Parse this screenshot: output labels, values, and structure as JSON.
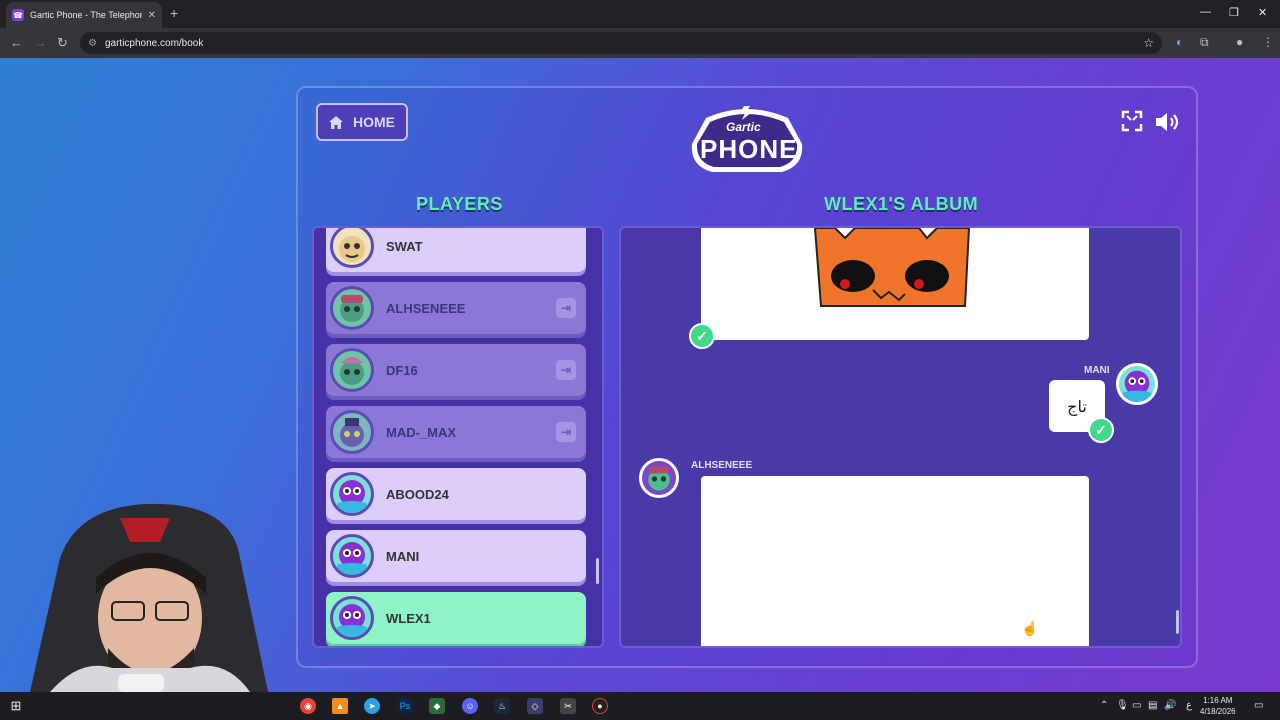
{
  "browser": {
    "tab_title": "Gartic Phone - The Telephone Game",
    "url": "garticphone.com/book"
  },
  "app": {
    "home_label": "HOME",
    "logo_top": "Gartic",
    "logo_bottom": "PHONE",
    "players_heading": "PLAYERS",
    "album_heading": "WLEX1'S ALBUM"
  },
  "players": [
    {
      "name": "SWAT",
      "state": "active"
    },
    {
      "name": "ALHSENEEE",
      "state": "away"
    },
    {
      "name": "DF16",
      "state": "away"
    },
    {
      "name": "MAD-_MAX",
      "state": "away"
    },
    {
      "name": "ABOOD24",
      "state": "active"
    },
    {
      "name": "MANI",
      "state": "active"
    },
    {
      "name": "WLEX1",
      "state": "me"
    }
  ],
  "album": {
    "guess_author": "MANI",
    "guess_text": "تاج",
    "drawing_author": "ALHSENEEE"
  },
  "taskbar": {
    "lang": "ع",
    "time": "1:16 AM",
    "date": "4/18/2026"
  },
  "colors": {
    "accent_green": "#5df0b8",
    "active_player": "#dccdfb",
    "me_player": "#8ff3c9",
    "away_player": "#8b78d6"
  }
}
